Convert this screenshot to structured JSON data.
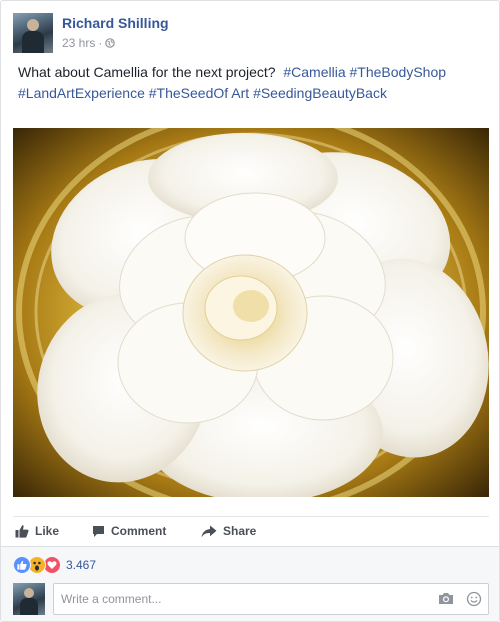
{
  "post": {
    "author": "Richard Shilling",
    "time": "23 hrs",
    "separator": "·",
    "text_plain": "What about Camellia for the next project?",
    "hashtags_line1": [
      "#Camellia",
      "#TheBodyShop"
    ],
    "hashtags_line2": [
      "#LandArtExperience",
      "#TheSeedOf Art",
      "#SeedingBeautyBack"
    ],
    "photo_icon": "camellia-flower-photo"
  },
  "actions": {
    "like": "Like",
    "comment": "Comment",
    "share": "Share"
  },
  "reactions": {
    "types": [
      "like",
      "wow",
      "love"
    ],
    "count": "3.467"
  },
  "comment_box": {
    "placeholder": "Write a comment..."
  },
  "colors": {
    "link": "#365899",
    "meta": "#90949c",
    "like_blue": "#5890ff",
    "wow_yellow": "#f7b125",
    "love_red": "#f25268"
  }
}
